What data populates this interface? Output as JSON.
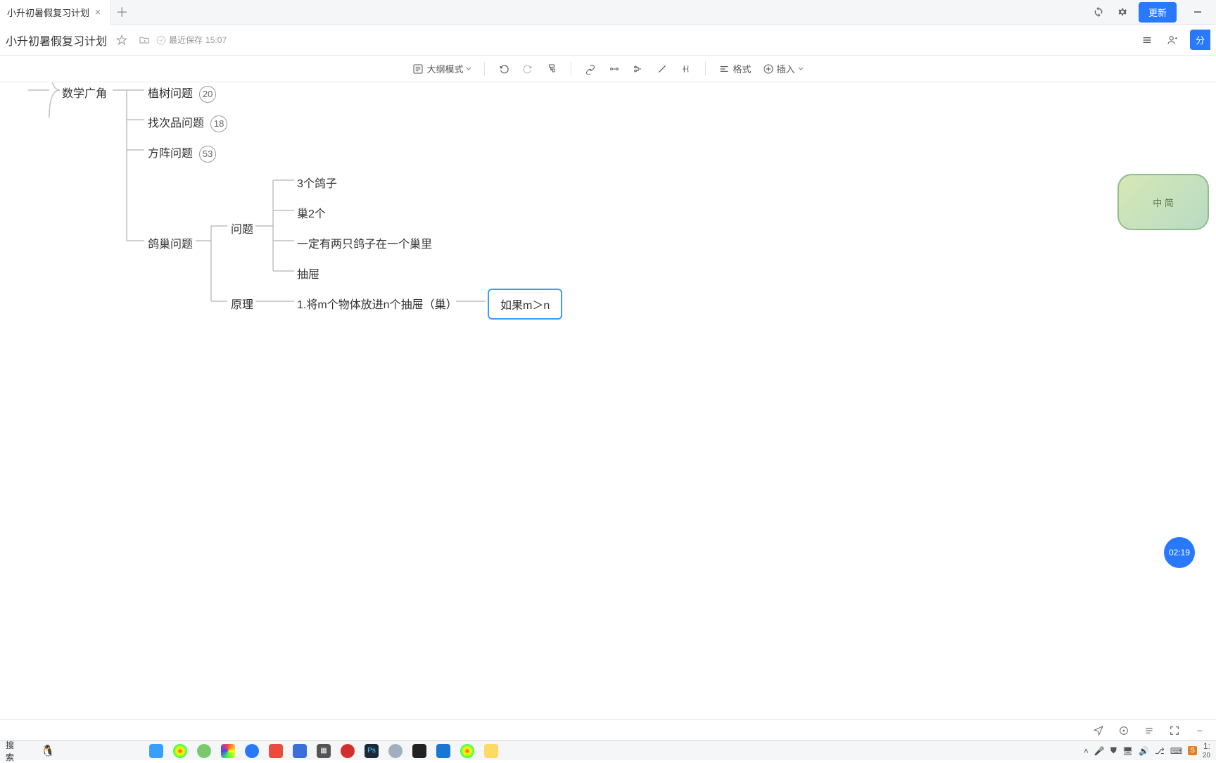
{
  "tab": {
    "title": "小升初暑假复习计划"
  },
  "header": {
    "doc_title": "小升初暑假复习计划",
    "save_prefix": "最近保存",
    "save_time": "15:07",
    "update_btn": "更新"
  },
  "toolbar": {
    "outline": "大纲模式",
    "format": "格式",
    "insert": "插入"
  },
  "mindmap": {
    "root": "数学广角",
    "branches": [
      {
        "label": "植树问题",
        "badge": "20"
      },
      {
        "label": "找次品问题",
        "badge": "18"
      },
      {
        "label": "方阵问题",
        "badge": "53"
      },
      {
        "label": "鸽巢问题",
        "children": [
          {
            "label": "问题",
            "children": [
              {
                "label": "3个鸽子"
              },
              {
                "label": "巢2个"
              },
              {
                "label": "一定有两只鸽子在一个巢里"
              },
              {
                "label": "抽屉"
              }
            ]
          },
          {
            "label": "原理",
            "children": [
              {
                "label": "1.将m个物体放进n个抽屉（巢）",
                "children": [
                  {
                    "label": "如果m＞n",
                    "selected": true
                  }
                ]
              }
            ]
          }
        ]
      }
    ]
  },
  "decor": {
    "text": "中 简"
  },
  "timer": {
    "value": "02:19"
  },
  "taskbar": {
    "search": "搜索",
    "time_short": "1:",
    "date_short": "20"
  },
  "chart_data": {
    "type": "tree",
    "title": "数学广角 mind-map (partial)",
    "root": "数学广角",
    "nodes": [
      {
        "id": "root",
        "label": "数学广角",
        "parent": null
      },
      {
        "id": "n1",
        "label": "植树问题",
        "parent": "root",
        "annotation": 20
      },
      {
        "id": "n2",
        "label": "找次品问题",
        "parent": "root",
        "annotation": 18
      },
      {
        "id": "n3",
        "label": "方阵问题",
        "parent": "root",
        "annotation": 53
      },
      {
        "id": "n4",
        "label": "鸽巢问题",
        "parent": "root"
      },
      {
        "id": "n4a",
        "label": "问题",
        "parent": "n4"
      },
      {
        "id": "n4a1",
        "label": "3个鸽子",
        "parent": "n4a"
      },
      {
        "id": "n4a2",
        "label": "巢2个",
        "parent": "n4a"
      },
      {
        "id": "n4a3",
        "label": "一定有两只鸽子在一个巢里",
        "parent": "n4a"
      },
      {
        "id": "n4a4",
        "label": "抽屉",
        "parent": "n4a"
      },
      {
        "id": "n4b",
        "label": "原理",
        "parent": "n4"
      },
      {
        "id": "n4b1",
        "label": "1.将m个物体放进n个抽屉（巢）",
        "parent": "n4b"
      },
      {
        "id": "n4b1a",
        "label": "如果m＞n",
        "parent": "n4b1",
        "selected": true
      }
    ]
  }
}
